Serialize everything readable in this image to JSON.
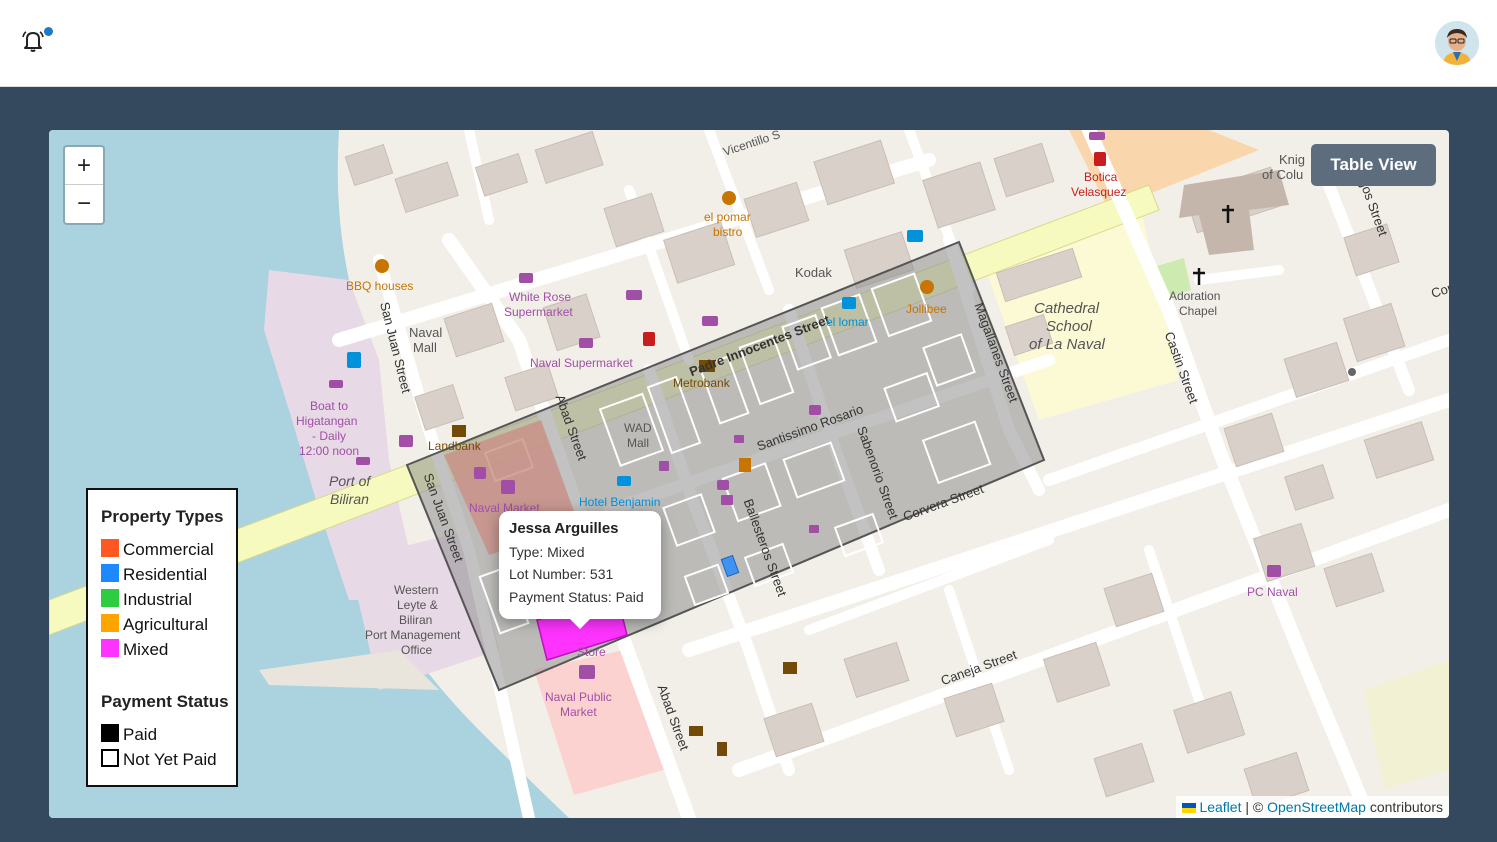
{
  "header": {
    "bell_icon": "bell-icon",
    "avatar_icon": "user-avatar"
  },
  "map": {
    "zoom_in": "+",
    "zoom_out": "−",
    "table_view": "Table View",
    "labels": {
      "vicentillo": "Vicentillo S",
      "padre": "Padre Innocentes Street",
      "abad": "Abad Street",
      "abad2": "Abad Street",
      "sanjuan": "San Juan Street",
      "sanjuan2": "San Juan Street",
      "magallanes": "Magallanes Street",
      "santissimo": "Santissimo Rosario",
      "sabenorio": "Sabenorio Street",
      "ballesteros": "Ballesteros Street",
      "corvera": "Corvera Street",
      "caneja": "Caneja Street",
      "castin": "Castin Street",
      "bbq": "BBQ houses",
      "whiterose": "White Rose",
      "whiterose2": "Supermarket",
      "navalsuper": "Naval Supermarket",
      "navalmall": "Naval",
      "navalmall2": "Mall",
      "elpomar": "el pomar",
      "elpomar2": "bistro",
      "kodak": "Kodak",
      "jollibee": "Jollibee",
      "ellomar": "el lomar",
      "cathedral": "Cathedral",
      "cathedral2": "School",
      "cathedral3": "of La Naval",
      "adoration": "Adoration",
      "adoration2": "Chapel",
      "botica": "Botica",
      "botica2": "Velasquez",
      "knight": "Knig",
      "knight2": "of Colu",
      "boat": "Boat to",
      "boat2": "Higatangan",
      "boat3": "- Daily",
      "boat4": "12:00 noon",
      "port": "Port of",
      "port2": "Biliran",
      "landbank": "Landbank",
      "wad": "WAD",
      "wad2": "Mall",
      "hotel": "Hotel Benjamin",
      "navalmarket": "Naval Market",
      "western": "Western",
      "western2": "Leyte &",
      "western3": "Biliran",
      "western4": "Port Management",
      "western5": "Office",
      "publicmarket": "Naval Public",
      "publicmarket2": "Market",
      "store": "Store",
      "pcnaval": "PC Naval",
      "metrobank": "Metrobank",
      "gos": "gos Street",
      "cor": "Cor"
    }
  },
  "legend": {
    "types_title": "Property Types",
    "types": [
      {
        "label": "Commercial",
        "color": "#ff5722"
      },
      {
        "label": "Residential",
        "color": "#1e88ff"
      },
      {
        "label": "Industrial",
        "color": "#2ecc40"
      },
      {
        "label": "Agricultural",
        "color": "#ffa500"
      },
      {
        "label": "Mixed",
        "color": "#ff33ff"
      }
    ],
    "status_title": "Payment Status",
    "status": [
      {
        "label": "Paid",
        "fill": "#000000"
      },
      {
        "label": "Not Yet Paid",
        "fill": "#ffffff"
      }
    ]
  },
  "popup": {
    "name": "Jessa Arguilles",
    "type": "Type: Mixed",
    "lot": "Lot Number: 531",
    "status": "Payment Status: Paid"
  },
  "attribution": {
    "leaflet": "Leaflet",
    "sep": "| ©",
    "osm": "OpenStreetMap",
    "contributors": "contributors"
  }
}
